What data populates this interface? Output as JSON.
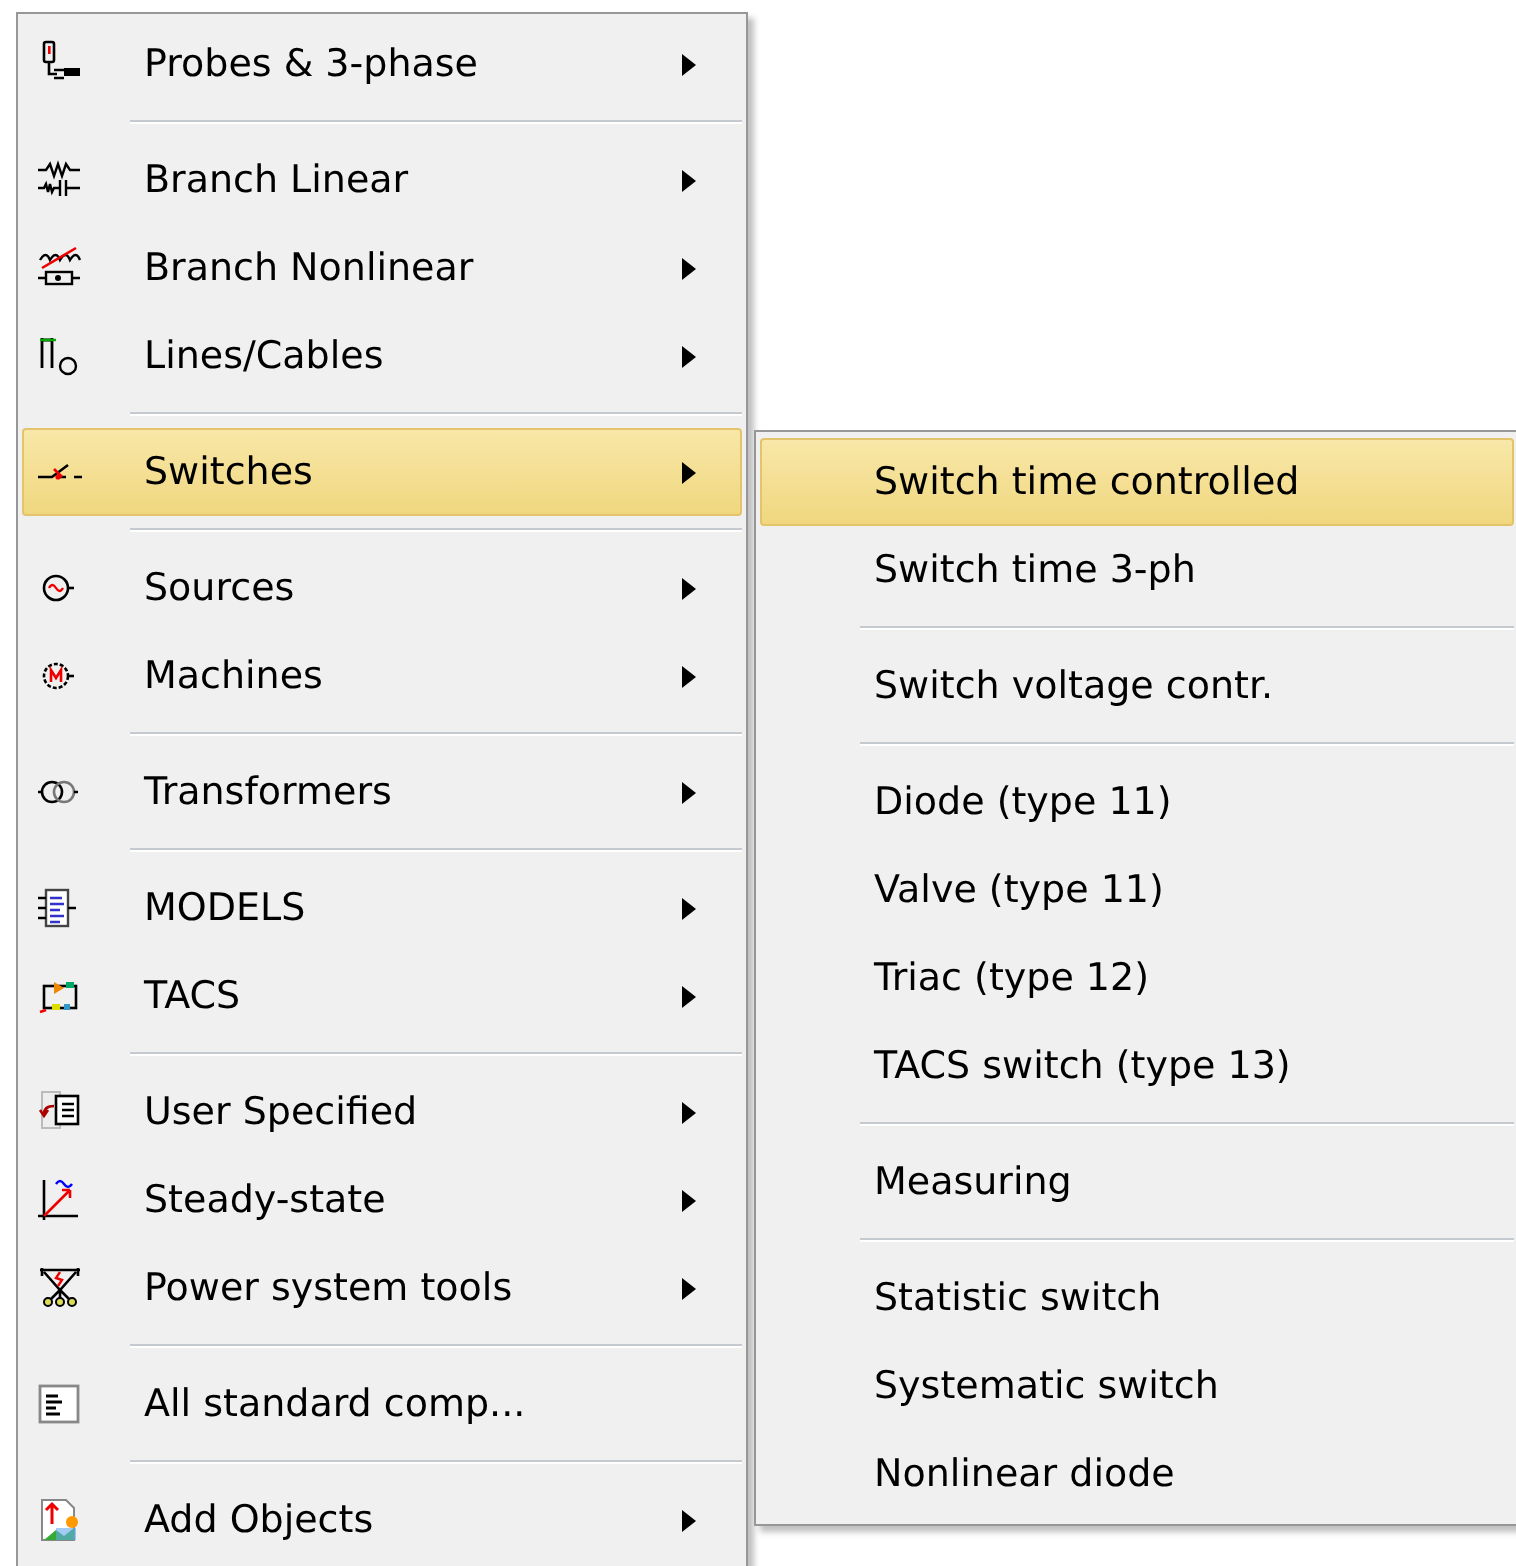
{
  "menu": {
    "items": [
      {
        "kind": "probe",
        "label": "Probes & 3-phase",
        "submenu": true,
        "selected": false
      },
      {
        "kind": "separator"
      },
      {
        "kind": "branch",
        "label": "Branch Linear",
        "submenu": true,
        "selected": false
      },
      {
        "kind": "nonlinear",
        "label": "Branch Nonlinear",
        "submenu": true,
        "selected": false
      },
      {
        "kind": "line",
        "label": "Lines/Cables",
        "submenu": true,
        "selected": false
      },
      {
        "kind": "separator"
      },
      {
        "kind": "switch",
        "label": "Switches",
        "submenu": true,
        "selected": true
      },
      {
        "kind": "separator"
      },
      {
        "kind": "source",
        "label": "Sources",
        "submenu": true,
        "selected": false
      },
      {
        "kind": "machine",
        "label": "Machines",
        "submenu": true,
        "selected": false
      },
      {
        "kind": "separator"
      },
      {
        "kind": "transformer",
        "label": "Transformers",
        "submenu": true,
        "selected": false
      },
      {
        "kind": "separator"
      },
      {
        "kind": "models",
        "label": "MODELS",
        "submenu": true,
        "selected": false
      },
      {
        "kind": "tacs",
        "label": "TACS",
        "submenu": true,
        "selected": false
      },
      {
        "kind": "separator"
      },
      {
        "kind": "user",
        "label": "User Specified",
        "submenu": true,
        "selected": false
      },
      {
        "kind": "steady",
        "label": "Steady-state",
        "submenu": true,
        "selected": false
      },
      {
        "kind": "power",
        "label": "Power system tools",
        "submenu": true,
        "selected": false
      },
      {
        "kind": "separator"
      },
      {
        "kind": "list",
        "label": "All standard comp...",
        "submenu": false,
        "selected": false
      },
      {
        "kind": "separator"
      },
      {
        "kind": "add",
        "label": "Add Objects",
        "submenu": true,
        "selected": false
      }
    ]
  },
  "submenu": {
    "items": [
      {
        "kind": "item",
        "label": "Switch time controlled",
        "selected": true
      },
      {
        "kind": "item",
        "label": "Switch time 3-ph",
        "selected": false
      },
      {
        "kind": "separator"
      },
      {
        "kind": "item",
        "label": "Switch voltage contr.",
        "selected": false
      },
      {
        "kind": "separator"
      },
      {
        "kind": "item",
        "label": "Diode (type 11)",
        "selected": false
      },
      {
        "kind": "item",
        "label": "Valve (type 11)",
        "selected": false
      },
      {
        "kind": "item",
        "label": "Triac (type 12)",
        "selected": false
      },
      {
        "kind": "item",
        "label": "TACS switch (type 13)",
        "selected": false
      },
      {
        "kind": "separator"
      },
      {
        "kind": "item",
        "label": "Measuring",
        "selected": false
      },
      {
        "kind": "separator"
      },
      {
        "kind": "item",
        "label": "Statistic switch",
        "selected": false
      },
      {
        "kind": "item",
        "label": "Systematic switch",
        "selected": false
      },
      {
        "kind": "item",
        "label": "Nonlinear diode",
        "selected": false
      }
    ]
  }
}
